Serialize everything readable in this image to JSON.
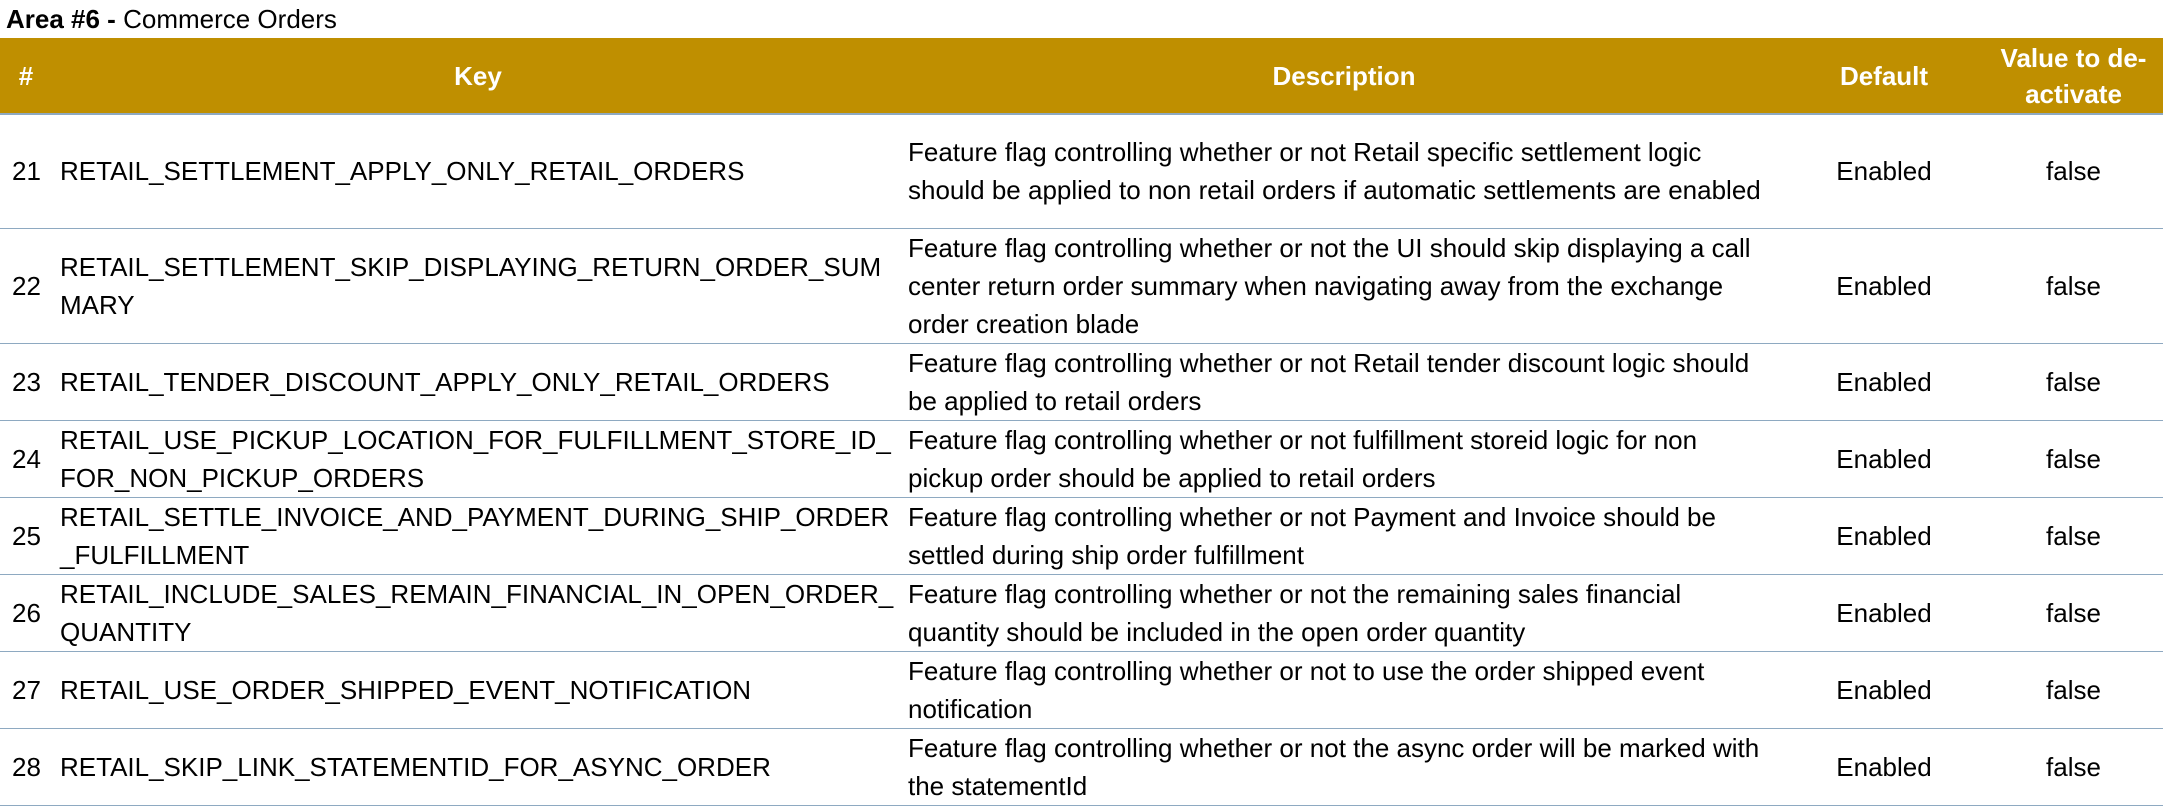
{
  "area": {
    "label": "Area #6 -",
    "name": "Commerce Orders"
  },
  "colors": {
    "header_bg": "#bf8f00",
    "header_text": "#ffffff",
    "row_divider": "#8ea9c1"
  },
  "table": {
    "headers": {
      "num": "#",
      "key": "Key",
      "description": "Description",
      "default": "Default",
      "value": "Value to de-activate"
    },
    "rows": [
      {
        "num": "21",
        "key": "RETAIL_SETTLEMENT_APPLY_ONLY_RETAIL_ORDERS",
        "description": "Feature flag controlling whether or not Retail specific settlement logic should be applied to non retail orders if automatic settlements are enabled",
        "default": "Enabled",
        "value": "false"
      },
      {
        "num": "22",
        "key": "RETAIL_SETTLEMENT_SKIP_DISPLAYING_RETURN_ORDER_SUMMARY",
        "description": "Feature flag controlling whether or not the UI should skip displaying a call center return order summary when navigating away from the exchange order creation blade",
        "default": "Enabled",
        "value": "false"
      },
      {
        "num": "23",
        "key": "RETAIL_TENDER_DISCOUNT_APPLY_ONLY_RETAIL_ORDERS",
        "description": "Feature flag controlling whether or not Retail tender discount logic should be applied to retail orders",
        "default": "Enabled",
        "value": "false"
      },
      {
        "num": "24",
        "key": "RETAIL_USE_PICKUP_LOCATION_FOR_FULFILLMENT_STORE_ID_FOR_NON_PICKUP_ORDERS",
        "description": "Feature flag controlling whether or not fulfillment storeid logic for non pickup order should be applied to retail orders",
        "default": "Enabled",
        "value": "false"
      },
      {
        "num": "25",
        "key": "RETAIL_SETTLE_INVOICE_AND_PAYMENT_DURING_SHIP_ORDER_FULFILLMENT",
        "description": " Feature flag controlling whether or not Payment and Invoice should be settled during ship order fulfillment",
        "default": "Enabled",
        "value": "false"
      },
      {
        "num": "26",
        "key": "RETAIL_INCLUDE_SALES_REMAIN_FINANCIAL_IN_OPEN_ORDER_QUANTITY",
        "description": "Feature flag controlling whether or not the remaining sales financial quantity should be included in the open order quantity",
        "default": "Enabled",
        "value": "false"
      },
      {
        "num": "27",
        "key": "RETAIL_USE_ORDER_SHIPPED_EVENT_NOTIFICATION",
        "description": "Feature flag controlling whether or not to use the order shipped event notification",
        "default": "Enabled",
        "value": "false"
      },
      {
        "num": "28",
        "key": "RETAIL_SKIP_LINK_STATEMENTID_FOR_ASYNC_ORDER",
        "description": "Feature flag controlling whether or not the async order will be marked with the statementId",
        "default": "Enabled",
        "value": "false"
      }
    ]
  }
}
